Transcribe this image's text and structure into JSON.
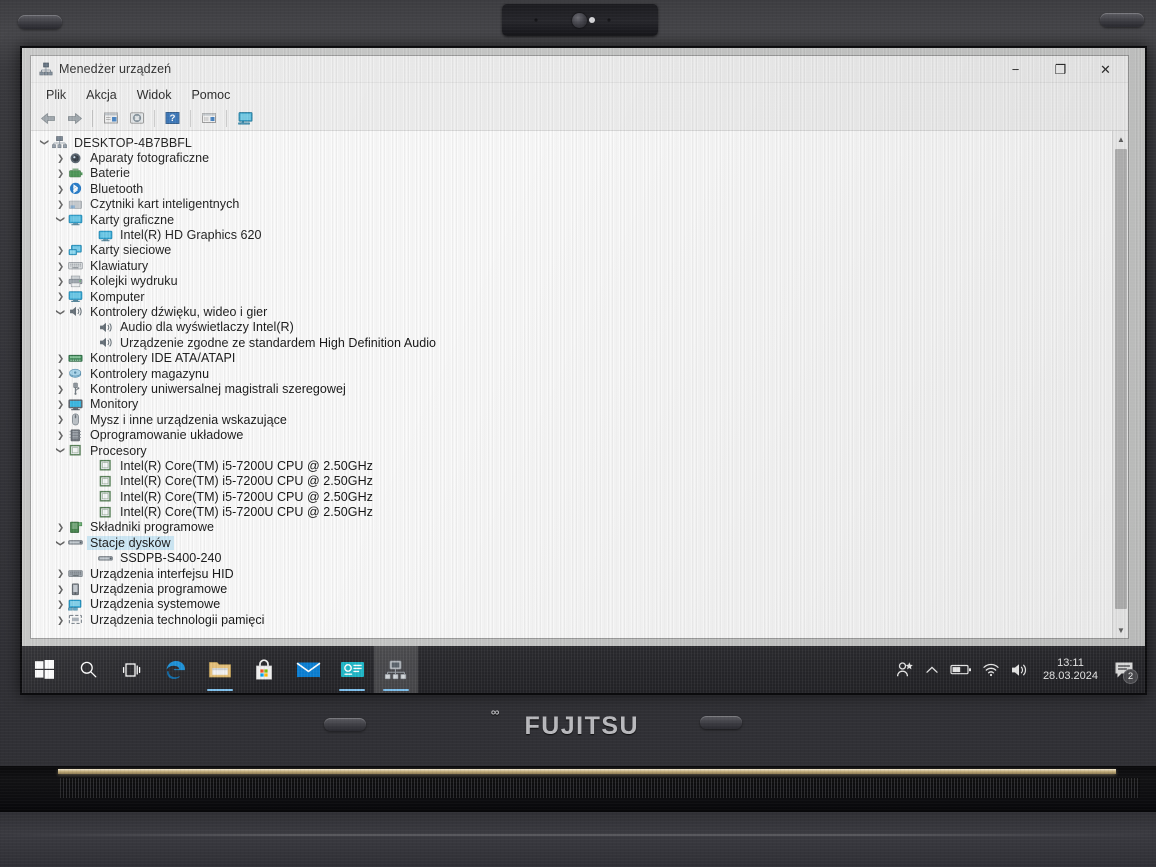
{
  "device": {
    "brand": "FUJITSU",
    "brand_mark": "∞"
  },
  "window": {
    "title": "Menedżer urządzeń",
    "title_icon": "device-manager-icon",
    "controls": {
      "minimize": "−",
      "maximize": "❐",
      "close": "✕"
    }
  },
  "menubar": {
    "items": [
      {
        "label": "Plik"
      },
      {
        "label": "Akcja"
      },
      {
        "label": "Widok"
      },
      {
        "label": "Pomoc"
      }
    ]
  },
  "toolbar": {
    "buttons": [
      {
        "name": "back-button",
        "icon": "left-arrow-icon"
      },
      {
        "name": "forward-button",
        "icon": "right-arrow-icon"
      },
      {
        "name": "properties-button",
        "icon": "properties-icon"
      },
      {
        "name": "update-driver-button",
        "icon": "update-driver-icon"
      },
      {
        "name": "help-button",
        "icon": "help-icon"
      },
      {
        "name": "show-hidden-devices-button",
        "icon": "show-hidden-devices-icon"
      },
      {
        "name": "scan-hardware-button",
        "icon": "scan-hardware-icon"
      }
    ]
  },
  "tree": {
    "nodes": [
      {
        "label": "DESKTOP-4B7BBFL",
        "level": 0,
        "state": "expanded",
        "icon": "computer-network-icon",
        "selected": false
      },
      {
        "label": "Aparaty fotograficzne",
        "level": 1,
        "state": "collapsed",
        "icon": "camera-icon",
        "selected": false
      },
      {
        "label": "Baterie",
        "level": 1,
        "state": "collapsed",
        "icon": "battery-icon",
        "selected": false
      },
      {
        "label": "Bluetooth",
        "level": 1,
        "state": "collapsed",
        "icon": "bluetooth-icon",
        "selected": false
      },
      {
        "label": "Czytniki kart inteligentnych",
        "level": 1,
        "state": "collapsed",
        "icon": "smartcard-reader-icon",
        "selected": false
      },
      {
        "label": "Karty graficzne",
        "level": 1,
        "state": "expanded",
        "icon": "display-adapter-icon",
        "selected": false
      },
      {
        "label": "Intel(R) HD Graphics 620",
        "level": 2,
        "state": "leaf",
        "icon": "display-adapter-icon",
        "selected": false
      },
      {
        "label": "Karty sieciowe",
        "level": 1,
        "state": "collapsed",
        "icon": "network-adapter-icon",
        "selected": false
      },
      {
        "label": "Klawiatury",
        "level": 1,
        "state": "collapsed",
        "icon": "keyboard-icon",
        "selected": false
      },
      {
        "label": "Kolejki wydruku",
        "level": 1,
        "state": "collapsed",
        "icon": "printer-icon",
        "selected": false
      },
      {
        "label": "Komputer",
        "level": 1,
        "state": "collapsed",
        "icon": "computer-icon",
        "selected": false
      },
      {
        "label": "Kontrolery dźwięku, wideo i gier",
        "level": 1,
        "state": "expanded",
        "icon": "sound-icon",
        "selected": false
      },
      {
        "label": "Audio dla wyświetlaczy Intel(R)",
        "level": 2,
        "state": "leaf",
        "icon": "sound-icon",
        "selected": false
      },
      {
        "label": "Urządzenie zgodne ze standardem High Definition Audio",
        "level": 2,
        "state": "leaf",
        "icon": "sound-icon",
        "selected": false
      },
      {
        "label": "Kontrolery IDE ATA/ATAPI",
        "level": 1,
        "state": "collapsed",
        "icon": "ide-controller-icon",
        "selected": false
      },
      {
        "label": "Kontrolery magazynu",
        "level": 1,
        "state": "collapsed",
        "icon": "storage-controller-icon",
        "selected": false
      },
      {
        "label": "Kontrolery uniwersalnej magistrali szeregowej",
        "level": 1,
        "state": "collapsed",
        "icon": "usb-controller-icon",
        "selected": false
      },
      {
        "label": "Monitory",
        "level": 1,
        "state": "collapsed",
        "icon": "monitor-icon",
        "selected": false
      },
      {
        "label": "Mysz i inne urządzenia wskazujące",
        "level": 1,
        "state": "collapsed",
        "icon": "mouse-icon",
        "selected": false
      },
      {
        "label": "Oprogramowanie układowe",
        "level": 1,
        "state": "collapsed",
        "icon": "firmware-icon",
        "selected": false
      },
      {
        "label": "Procesory",
        "level": 1,
        "state": "expanded",
        "icon": "processor-icon",
        "selected": false
      },
      {
        "label": "Intel(R) Core(TM) i5-7200U CPU @ 2.50GHz",
        "level": 2,
        "state": "leaf",
        "icon": "processor-icon",
        "selected": false
      },
      {
        "label": "Intel(R) Core(TM) i5-7200U CPU @ 2.50GHz",
        "level": 2,
        "state": "leaf",
        "icon": "processor-icon",
        "selected": false
      },
      {
        "label": "Intel(R) Core(TM) i5-7200U CPU @ 2.50GHz",
        "level": 2,
        "state": "leaf",
        "icon": "processor-icon",
        "selected": false
      },
      {
        "label": "Intel(R) Core(TM) i5-7200U CPU @ 2.50GHz",
        "level": 2,
        "state": "leaf",
        "icon": "processor-icon",
        "selected": false
      },
      {
        "label": "Składniki programowe",
        "level": 1,
        "state": "collapsed",
        "icon": "software-component-icon",
        "selected": false
      },
      {
        "label": "Stacje dysków",
        "level": 1,
        "state": "expanded",
        "icon": "disk-drive-icon",
        "selected": true
      },
      {
        "label": "SSDPB-S400-240",
        "level": 2,
        "state": "leaf",
        "icon": "disk-drive-icon",
        "selected": false
      },
      {
        "label": "Urządzenia interfejsu HID",
        "level": 1,
        "state": "collapsed",
        "icon": "hid-device-icon",
        "selected": false
      },
      {
        "label": "Urządzenia programowe",
        "level": 1,
        "state": "collapsed",
        "icon": "software-device-icon",
        "selected": false
      },
      {
        "label": "Urządzenia systemowe",
        "level": 1,
        "state": "collapsed",
        "icon": "system-device-icon",
        "selected": false
      },
      {
        "label": "Urządzenia technologii pamięci",
        "level": 1,
        "state": "collapsed",
        "icon": "memory-technology-icon",
        "selected": false
      }
    ],
    "chevron_collapsed": "❯",
    "chevron_expanded": "❯"
  },
  "scrollbar": {
    "up_arrow": "▲",
    "down_arrow": "▼"
  },
  "taskbar": {
    "items": [
      {
        "name": "start-button",
        "icon": "windows-logo-icon",
        "active": false,
        "running": false
      },
      {
        "name": "search-button",
        "icon": "search-icon",
        "active": false,
        "running": false
      },
      {
        "name": "task-view-button",
        "icon": "task-view-icon",
        "active": false,
        "running": false
      },
      {
        "name": "edge-button",
        "icon": "edge-browser-icon",
        "active": false,
        "running": false
      },
      {
        "name": "file-explorer-button",
        "icon": "file-explorer-icon",
        "active": false,
        "running": true
      },
      {
        "name": "microsoft-store-button",
        "icon": "store-icon",
        "active": false,
        "running": false
      },
      {
        "name": "mail-button",
        "icon": "mail-icon",
        "active": false,
        "running": false
      },
      {
        "name": "teal-app-button",
        "icon": "card-app-icon",
        "active": false,
        "running": true
      },
      {
        "name": "device-manager-taskbar-button",
        "icon": "device-manager-icon",
        "active": true,
        "running": true
      }
    ],
    "tray": {
      "people": "people-icon",
      "show_hidden": "chevron-up-icon",
      "battery": "battery-icon",
      "network": "wifi-icon",
      "volume": "speaker-icon",
      "time": "13:11",
      "date": "28.03.2024",
      "notification_icon": "action-center-icon",
      "notification_count": "2"
    }
  },
  "colors": {
    "selection": "#cde8f7",
    "taskbar": "#232327",
    "accent": "#0078d7",
    "window_bg": "#f0f0f0",
    "screen_bg": "#c7c8c7"
  }
}
